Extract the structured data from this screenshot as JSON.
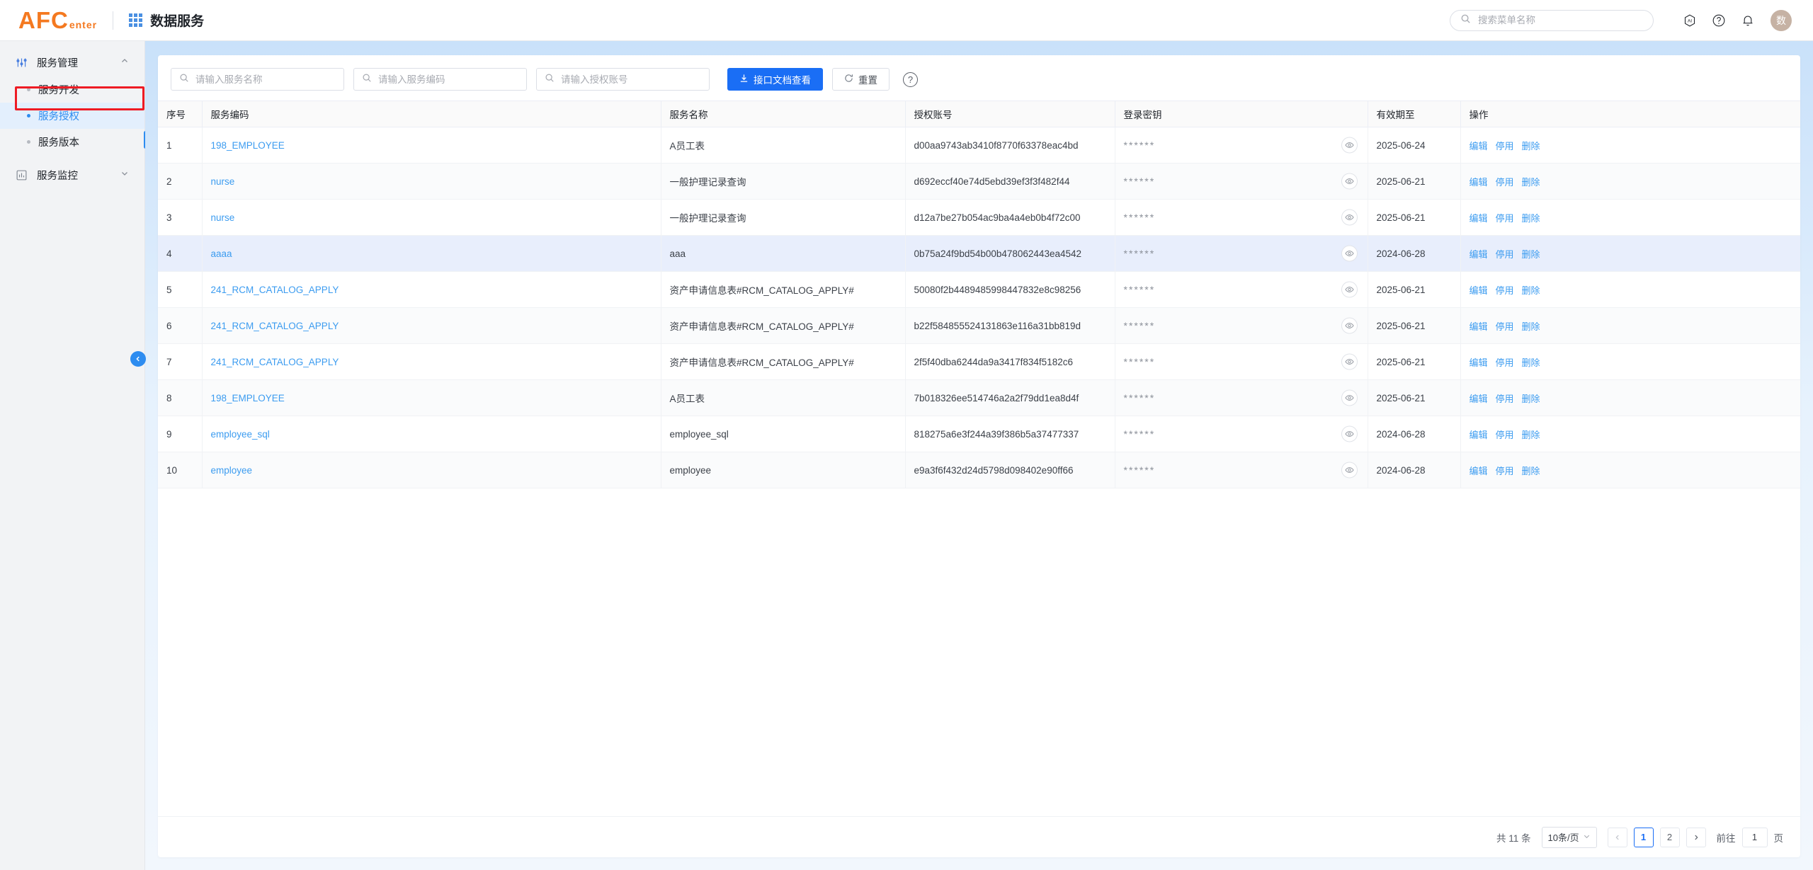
{
  "topbar": {
    "logo_main": "AFC",
    "logo_sub": "enter",
    "app_title": "数据服务",
    "search_placeholder": "搜索菜单名称",
    "search_value": "",
    "avatar_text": "数",
    "icons": [
      "ai-icon",
      "help-icon",
      "bell-icon"
    ]
  },
  "sidebar": {
    "groups": [
      {
        "label": "服务管理",
        "icon": "sliders-icon",
        "expanded": true,
        "items": [
          {
            "label": "服务开发",
            "active": false
          },
          {
            "label": "服务授权",
            "active": true
          },
          {
            "label": "服务版本",
            "active": false
          }
        ]
      },
      {
        "label": "服务监控",
        "icon": "chart-icon",
        "expanded": false,
        "items": []
      }
    ]
  },
  "filters": {
    "service_name_placeholder": "请输入服务名称",
    "service_name_value": "",
    "service_code_placeholder": "请输入服务编码",
    "service_code_value": "",
    "auth_account_placeholder": "请输入授权账号",
    "auth_account_value": "",
    "doc_button": "接口文档查看",
    "reset_button": "重置",
    "help_label": "?"
  },
  "table": {
    "columns": [
      "序号",
      "服务编码",
      "服务名称",
      "授权账号",
      "登录密钥",
      "有效期至",
      "操作"
    ],
    "secret_mask": "******",
    "ops": [
      "编辑",
      "停用",
      "删除"
    ],
    "rows": [
      {
        "no": "1",
        "code": "198_EMPLOYEE",
        "name": "A员工表",
        "account": "d00aa9743ab3410f8770f63378eac4bd",
        "expire": "2025-06-24",
        "selected": false
      },
      {
        "no": "2",
        "code": "nurse",
        "name": "一般护理记录查询",
        "account": "d692eccf40e74d5ebd39ef3f3f482f44",
        "expire": "2025-06-21",
        "selected": false
      },
      {
        "no": "3",
        "code": "nurse",
        "name": "一般护理记录查询",
        "account": "d12a7be27b054ac9ba4a4eb0b4f72c00",
        "expire": "2025-06-21",
        "selected": false
      },
      {
        "no": "4",
        "code": "aaaa",
        "name": "aaa",
        "account": "0b75a24f9bd54b00b478062443ea4542",
        "expire": "2024-06-28",
        "selected": true
      },
      {
        "no": "5",
        "code": "241_RCM_CATALOG_APPLY",
        "name": "资产申请信息表#RCM_CATALOG_APPLY#",
        "account": "50080f2b4489485998447832e8c98256",
        "expire": "2025-06-21",
        "selected": false
      },
      {
        "no": "6",
        "code": "241_RCM_CATALOG_APPLY",
        "name": "资产申请信息表#RCM_CATALOG_APPLY#",
        "account": "b22f584855524131863e116a31bb819d",
        "expire": "2025-06-21",
        "selected": false
      },
      {
        "no": "7",
        "code": "241_RCM_CATALOG_APPLY",
        "name": "资产申请信息表#RCM_CATALOG_APPLY#",
        "account": "2f5f40dba6244da9a3417f834f5182c6",
        "expire": "2025-06-21",
        "selected": false
      },
      {
        "no": "8",
        "code": "198_EMPLOYEE",
        "name": "A员工表",
        "account": "7b018326ee514746a2a2f79dd1ea8d4f",
        "expire": "2025-06-21",
        "selected": false
      },
      {
        "no": "9",
        "code": "employee_sql",
        "name": "employee_sql",
        "account": "818275a6e3f244a39f386b5a37477337",
        "expire": "2024-06-28",
        "selected": false
      },
      {
        "no": "10",
        "code": "employee",
        "name": "employee",
        "account": "e9a3f6f432d24d5798d098402e90ff66",
        "expire": "2024-06-28",
        "selected": false
      }
    ]
  },
  "pagination": {
    "total_label": "共 11 条",
    "page_size_label": "10条/页",
    "pages": [
      "1",
      "2"
    ],
    "current_page": "1",
    "goto_label": "前往",
    "goto_value": "1",
    "goto_unit": "页"
  },
  "colors": {
    "brand_orange": "#f47920",
    "primary_blue": "#1a6ef5",
    "link_blue": "#3c9cf0",
    "annotation_red": "#ee1b24",
    "selected_row": "#e8eefc"
  }
}
